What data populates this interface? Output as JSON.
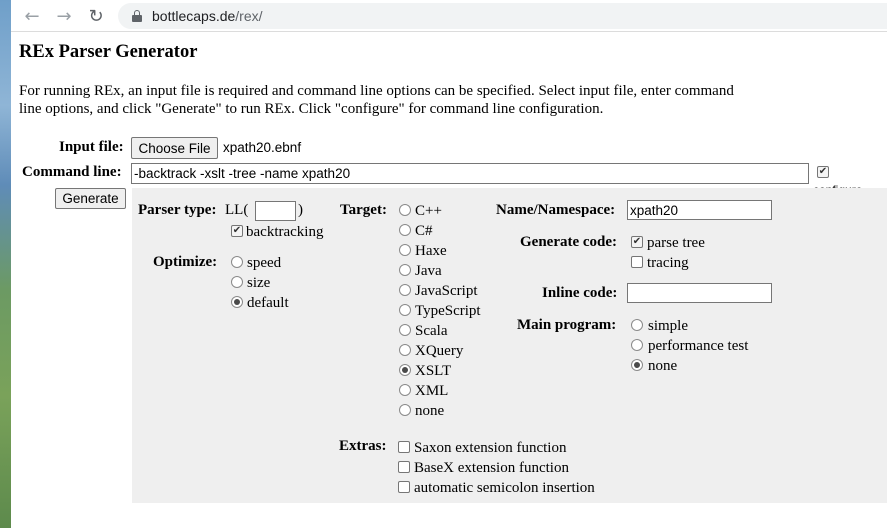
{
  "browser": {
    "url_host": "bottlecaps.de",
    "url_path": "/rex/"
  },
  "page": {
    "title": "REx Parser Generator",
    "intro_line1": "For running REx, an input file is required and command line options can be specified. Select input file, enter command",
    "intro_line2": "line options, and click \"Generate\" to run REx. Click \"configure\" for command line configuration."
  },
  "form": {
    "input_file_label": "Input file:",
    "choose_file_label": "Choose File",
    "file_name": "xpath20.ebnf",
    "command_line_label": "Command line:",
    "command_line_value": "-backtrack -xslt -tree -name xpath20",
    "configure_label": "configure",
    "configure_checked": true,
    "generate_label": "Generate"
  },
  "options": {
    "parser_type_label": "Parser type:",
    "ll_prefix": "LL(",
    "ll_suffix": ")",
    "ll_value": "",
    "backtracking_label": "backtracking",
    "optimize_label": "Optimize:",
    "optimize_options": [
      "speed",
      "size",
      "default"
    ],
    "optimize_selected": "default",
    "target_label": "Target:",
    "target_options": [
      "C++",
      "C#",
      "Haxe",
      "Java",
      "JavaScript",
      "TypeScript",
      "Scala",
      "XQuery",
      "XSLT",
      "XML",
      "none"
    ],
    "target_selected": "XSLT",
    "name_label": "Name/Namespace:",
    "name_value": "xpath20",
    "generate_code_label": "Generate code:",
    "parse_tree_label": "parse tree",
    "tracing_label": "tracing",
    "inline_code_label": "Inline code:",
    "inline_code_value": "",
    "main_program_label": "Main program:",
    "main_program_options": [
      "simple",
      "performance test",
      "none"
    ],
    "main_program_selected": "none",
    "extras_label": "Extras:",
    "extras_options": [
      "Saxon extension function",
      "BaseX extension function",
      "automatic semicolon insertion"
    ]
  }
}
